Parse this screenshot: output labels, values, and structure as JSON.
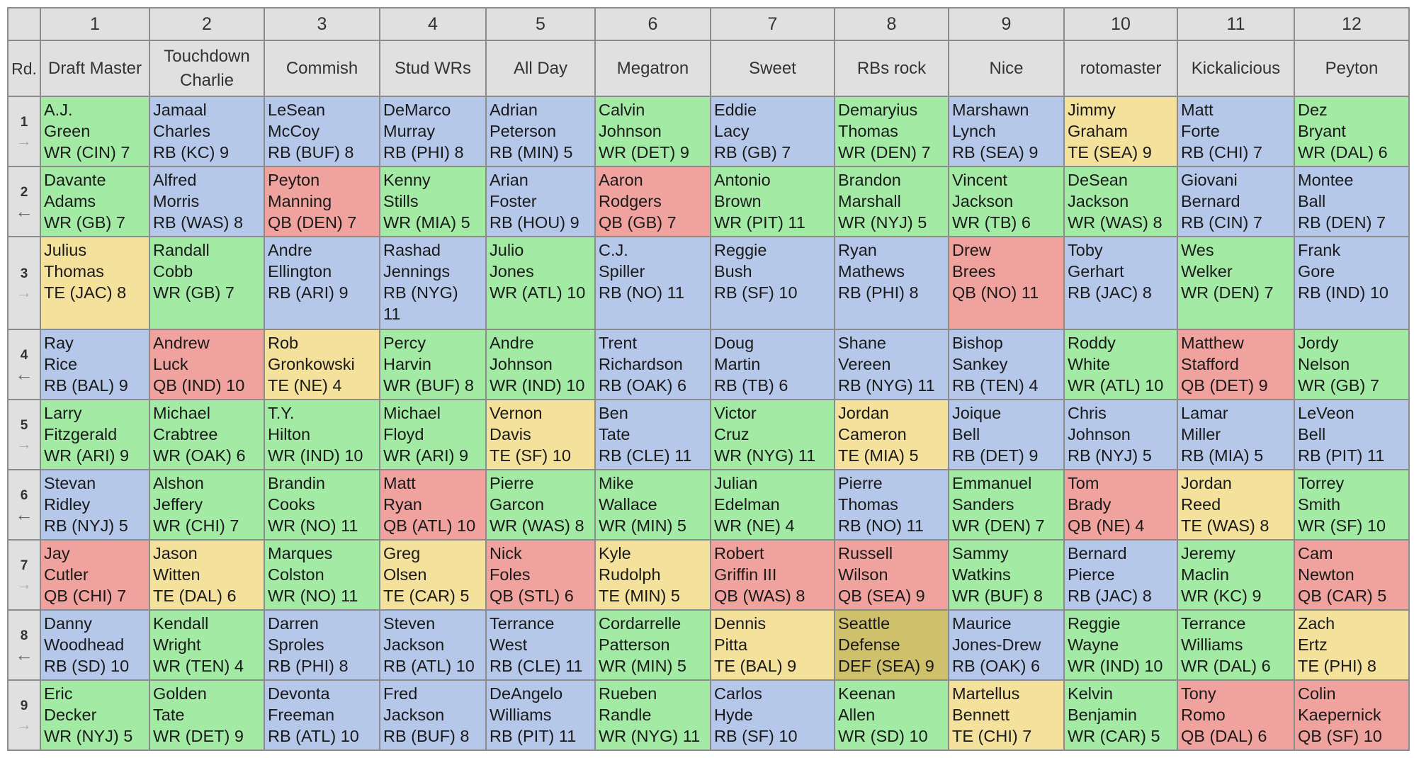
{
  "colors": {
    "WR": "#a3eba5",
    "RB": "#b6c8ea",
    "QB": "#f0a39e",
    "TE": "#f3e19c",
    "DEF": "#cfc06c",
    "header": "#e0e0e0"
  },
  "header": {
    "rd_label": "Rd.",
    "team_numbers": [
      "1",
      "2",
      "3",
      "4",
      "5",
      "6",
      "7",
      "8",
      "9",
      "10",
      "11",
      "12"
    ],
    "team_names": [
      "Draft Master",
      "Touchdown Charlie",
      "Commish",
      "Stud WRs",
      "All Day",
      "Megatron",
      "Sweet",
      "RBs rock",
      "Nice",
      "rotomaster",
      "Kickalicious",
      "Peyton"
    ]
  },
  "rounds": [
    {
      "num": "1",
      "direction": "right",
      "picks": [
        {
          "first": "A.J.",
          "last": "Green",
          "pos": "WR",
          "info": "WR (CIN) 7"
        },
        {
          "first": "Jamaal",
          "last": "Charles",
          "pos": "RB",
          "info": "RB (KC) 9"
        },
        {
          "first": "LeSean",
          "last": "McCoy",
          "pos": "RB",
          "info": "RB (BUF) 8"
        },
        {
          "first": "DeMarco",
          "last": "Murray",
          "pos": "RB",
          "info": "RB (PHI) 8"
        },
        {
          "first": "Adrian",
          "last": "Peterson",
          "pos": "RB",
          "info": "RB (MIN) 5"
        },
        {
          "first": "Calvin",
          "last": "Johnson",
          "pos": "WR",
          "info": "WR (DET) 9"
        },
        {
          "first": "Eddie",
          "last": "Lacy",
          "pos": "RB",
          "info": "RB (GB) 7"
        },
        {
          "first": "Demaryius",
          "last": "Thomas",
          "pos": "WR",
          "info": "WR (DEN) 7"
        },
        {
          "first": "Marshawn",
          "last": "Lynch",
          "pos": "RB",
          "info": "RB (SEA) 9"
        },
        {
          "first": "Jimmy",
          "last": "Graham",
          "pos": "TE",
          "info": "TE (SEA) 9"
        },
        {
          "first": "Matt",
          "last": "Forte",
          "pos": "RB",
          "info": "RB (CHI) 7"
        },
        {
          "first": "Dez",
          "last": "Bryant",
          "pos": "WR",
          "info": "WR (DAL) 6"
        }
      ]
    },
    {
      "num": "2",
      "direction": "left",
      "picks": [
        {
          "first": "Davante",
          "last": "Adams",
          "pos": "WR",
          "info": "WR (GB) 7"
        },
        {
          "first": "Alfred",
          "last": "Morris",
          "pos": "RB",
          "info": "RB (WAS) 8"
        },
        {
          "first": "Peyton",
          "last": "Manning",
          "pos": "QB",
          "info": "QB (DEN) 7"
        },
        {
          "first": "Kenny",
          "last": "Stills",
          "pos": "WR",
          "info": "WR (MIA) 5"
        },
        {
          "first": "Arian",
          "last": "Foster",
          "pos": "RB",
          "info": "RB (HOU) 9"
        },
        {
          "first": "Aaron",
          "last": "Rodgers",
          "pos": "QB",
          "info": "QB (GB) 7"
        },
        {
          "first": "Antonio",
          "last": "Brown",
          "pos": "WR",
          "info": "WR (PIT) 11"
        },
        {
          "first": "Brandon",
          "last": "Marshall",
          "pos": "WR",
          "info": "WR (NYJ) 5"
        },
        {
          "first": "Vincent",
          "last": "Jackson",
          "pos": "WR",
          "info": "WR (TB) 6"
        },
        {
          "first": "DeSean",
          "last": "Jackson",
          "pos": "WR",
          "info": "WR (WAS) 8"
        },
        {
          "first": "Giovani",
          "last": "Bernard",
          "pos": "RB",
          "info": "RB (CIN) 7"
        },
        {
          "first": "Montee",
          "last": "Ball",
          "pos": "RB",
          "info": "RB (DEN) 7"
        }
      ]
    },
    {
      "num": "3",
      "direction": "right",
      "picks": [
        {
          "first": "Julius",
          "last": "Thomas",
          "pos": "TE",
          "info": "TE (JAC) 8"
        },
        {
          "first": "Randall",
          "last": "Cobb",
          "pos": "WR",
          "info": "WR (GB) 7"
        },
        {
          "first": "Andre",
          "last": "Ellington",
          "pos": "RB",
          "info": "RB (ARI) 9"
        },
        {
          "first": "Rashad",
          "last": "Jennings",
          "pos": "RB",
          "info": "RB (NYG)",
          "extra": "11"
        },
        {
          "first": "Julio",
          "last": "Jones",
          "pos": "WR",
          "info": "WR (ATL) 10"
        },
        {
          "first": "C.J.",
          "last": "Spiller",
          "pos": "RB",
          "info": "RB (NO) 11"
        },
        {
          "first": "Reggie",
          "last": "Bush",
          "pos": "RB",
          "info": "RB (SF) 10"
        },
        {
          "first": "Ryan",
          "last": "Mathews",
          "pos": "RB",
          "info": "RB (PHI) 8"
        },
        {
          "first": "Drew",
          "last": "Brees",
          "pos": "QB",
          "info": "QB (NO) 11"
        },
        {
          "first": "Toby",
          "last": "Gerhart",
          "pos": "RB",
          "info": "RB (JAC) 8"
        },
        {
          "first": "Wes",
          "last": "Welker",
          "pos": "WR",
          "info": "WR (DEN) 7"
        },
        {
          "first": "Frank",
          "last": "Gore",
          "pos": "RB",
          "info": "RB (IND) 10"
        }
      ]
    },
    {
      "num": "4",
      "direction": "left",
      "picks": [
        {
          "first": "Ray",
          "last": "Rice",
          "pos": "RB",
          "info": "RB (BAL) 9"
        },
        {
          "first": "Andrew",
          "last": "Luck",
          "pos": "QB",
          "info": "QB (IND) 10"
        },
        {
          "first": "Rob",
          "last": "Gronkowski",
          "pos": "TE",
          "info": "TE (NE) 4"
        },
        {
          "first": "Percy",
          "last": "Harvin",
          "pos": "WR",
          "info": "WR (BUF) 8"
        },
        {
          "first": "Andre",
          "last": "Johnson",
          "pos": "WR",
          "info": "WR (IND) 10"
        },
        {
          "first": "Trent",
          "last": "Richardson",
          "pos": "RB",
          "info": "RB (OAK) 6"
        },
        {
          "first": "Doug",
          "last": "Martin",
          "pos": "RB",
          "info": "RB (TB) 6"
        },
        {
          "first": "Shane",
          "last": "Vereen",
          "pos": "RB",
          "info": "RB (NYG) 11"
        },
        {
          "first": "Bishop",
          "last": "Sankey",
          "pos": "RB",
          "info": "RB (TEN) 4"
        },
        {
          "first": "Roddy",
          "last": "White",
          "pos": "WR",
          "info": "WR (ATL) 10"
        },
        {
          "first": "Matthew",
          "last": "Stafford",
          "pos": "QB",
          "info": "QB (DET) 9"
        },
        {
          "first": "Jordy",
          "last": "Nelson",
          "pos": "WR",
          "info": "WR (GB) 7"
        }
      ]
    },
    {
      "num": "5",
      "direction": "right",
      "picks": [
        {
          "first": "Larry",
          "last": "Fitzgerald",
          "pos": "WR",
          "info": "WR (ARI) 9"
        },
        {
          "first": "Michael",
          "last": "Crabtree",
          "pos": "WR",
          "info": "WR (OAK) 6"
        },
        {
          "first": "T.Y.",
          "last": "Hilton",
          "pos": "WR",
          "info": "WR (IND) 10"
        },
        {
          "first": "Michael",
          "last": "Floyd",
          "pos": "WR",
          "info": "WR (ARI) 9"
        },
        {
          "first": "Vernon",
          "last": "Davis",
          "pos": "TE",
          "info": "TE (SF) 10"
        },
        {
          "first": "Ben",
          "last": "Tate",
          "pos": "RB",
          "info": "RB (CLE) 11"
        },
        {
          "first": "Victor",
          "last": "Cruz",
          "pos": "WR",
          "info": "WR (NYG) 11"
        },
        {
          "first": "Jordan",
          "last": "Cameron",
          "pos": "TE",
          "info": "TE (MIA) 5"
        },
        {
          "first": "Joique",
          "last": "Bell",
          "pos": "RB",
          "info": "RB (DET) 9"
        },
        {
          "first": "Chris",
          "last": "Johnson",
          "pos": "RB",
          "info": "RB (NYJ) 5"
        },
        {
          "first": "Lamar",
          "last": "Miller",
          "pos": "RB",
          "info": "RB (MIA) 5"
        },
        {
          "first": "LeVeon",
          "last": "Bell",
          "pos": "RB",
          "info": "RB (PIT) 11"
        }
      ]
    },
    {
      "num": "6",
      "direction": "left",
      "picks": [
        {
          "first": "Stevan",
          "last": "Ridley",
          "pos": "RB",
          "info": "RB (NYJ) 5"
        },
        {
          "first": "Alshon",
          "last": "Jeffery",
          "pos": "WR",
          "info": "WR (CHI) 7"
        },
        {
          "first": "Brandin",
          "last": "Cooks",
          "pos": "WR",
          "info": "WR (NO) 11"
        },
        {
          "first": "Matt",
          "last": "Ryan",
          "pos": "QB",
          "info": "QB (ATL) 10"
        },
        {
          "first": "Pierre",
          "last": "Garcon",
          "pos": "WR",
          "info": "WR (WAS) 8"
        },
        {
          "first": "Mike",
          "last": "Wallace",
          "pos": "WR",
          "info": "WR (MIN) 5"
        },
        {
          "first": "Julian",
          "last": "Edelman",
          "pos": "WR",
          "info": "WR (NE) 4"
        },
        {
          "first": "Pierre",
          "last": "Thomas",
          "pos": "RB",
          "info": "RB (NO) 11"
        },
        {
          "first": "Emmanuel",
          "last": "Sanders",
          "pos": "WR",
          "info": "WR (DEN) 7"
        },
        {
          "first": "Tom",
          "last": "Brady",
          "pos": "QB",
          "info": "QB (NE) 4"
        },
        {
          "first": "Jordan",
          "last": "Reed",
          "pos": "TE",
          "info": "TE (WAS) 8"
        },
        {
          "first": "Torrey",
          "last": "Smith",
          "pos": "WR",
          "info": "WR (SF) 10"
        }
      ]
    },
    {
      "num": "7",
      "direction": "right",
      "picks": [
        {
          "first": "Jay",
          "last": "Cutler",
          "pos": "QB",
          "info": "QB (CHI) 7"
        },
        {
          "first": "Jason",
          "last": "Witten",
          "pos": "TE",
          "info": "TE (DAL) 6"
        },
        {
          "first": "Marques",
          "last": "Colston",
          "pos": "WR",
          "info": "WR (NO) 11"
        },
        {
          "first": "Greg",
          "last": "Olsen",
          "pos": "TE",
          "info": "TE (CAR) 5"
        },
        {
          "first": "Nick",
          "last": "Foles",
          "pos": "QB",
          "info": "QB (STL) 6"
        },
        {
          "first": "Kyle",
          "last": "Rudolph",
          "pos": "TE",
          "info": "TE (MIN) 5"
        },
        {
          "first": "Robert",
          "last": "Griffin III",
          "pos": "QB",
          "info": "QB (WAS) 8"
        },
        {
          "first": "Russell",
          "last": "Wilson",
          "pos": "QB",
          "info": "QB (SEA) 9"
        },
        {
          "first": "Sammy",
          "last": "Watkins",
          "pos": "WR",
          "info": "WR (BUF) 8"
        },
        {
          "first": "Bernard",
          "last": "Pierce",
          "pos": "RB",
          "info": "RB (JAC) 8"
        },
        {
          "first": "Jeremy",
          "last": "Maclin",
          "pos": "WR",
          "info": "WR (KC) 9"
        },
        {
          "first": "Cam",
          "last": "Newton",
          "pos": "QB",
          "info": "QB (CAR) 5"
        }
      ]
    },
    {
      "num": "8",
      "direction": "left",
      "picks": [
        {
          "first": "Danny",
          "last": "Woodhead",
          "pos": "RB",
          "info": "RB (SD) 10"
        },
        {
          "first": "Kendall",
          "last": "Wright",
          "pos": "WR",
          "info": "WR (TEN) 4"
        },
        {
          "first": "Darren",
          "last": "Sproles",
          "pos": "RB",
          "info": "RB (PHI) 8"
        },
        {
          "first": "Steven",
          "last": "Jackson",
          "pos": "RB",
          "info": "RB (ATL) 10"
        },
        {
          "first": "Terrance",
          "last": "West",
          "pos": "RB",
          "info": "RB (CLE) 11"
        },
        {
          "first": "Cordarrelle",
          "last": "Patterson",
          "pos": "WR",
          "info": "WR (MIN) 5"
        },
        {
          "first": "Dennis",
          "last": "Pitta",
          "pos": "TE",
          "info": "TE (BAL) 9"
        },
        {
          "first": "Seattle",
          "last": "Defense",
          "pos": "DEF",
          "info": "DEF (SEA) 9"
        },
        {
          "first": "Maurice",
          "last": "Jones-Drew",
          "pos": "RB",
          "info": "RB (OAK) 6"
        },
        {
          "first": "Reggie",
          "last": "Wayne",
          "pos": "WR",
          "info": "WR (IND) 10"
        },
        {
          "first": "Terrance",
          "last": "Williams",
          "pos": "WR",
          "info": "WR (DAL) 6"
        },
        {
          "first": "Zach",
          "last": "Ertz",
          "pos": "TE",
          "info": "TE (PHI) 8"
        }
      ]
    },
    {
      "num": "9",
      "direction": "right",
      "picks": [
        {
          "first": "Eric",
          "last": "Decker",
          "pos": "WR",
          "info": "WR (NYJ) 5"
        },
        {
          "first": "Golden",
          "last": "Tate",
          "pos": "WR",
          "info": "WR (DET) 9"
        },
        {
          "first": "Devonta",
          "last": "Freeman",
          "pos": "RB",
          "info": "RB (ATL) 10"
        },
        {
          "first": "Fred",
          "last": "Jackson",
          "pos": "RB",
          "info": "RB (BUF) 8"
        },
        {
          "first": "DeAngelo",
          "last": "Williams",
          "pos": "RB",
          "info": "RB (PIT) 11"
        },
        {
          "first": "Rueben",
          "last": "Randle",
          "pos": "WR",
          "info": "WR (NYG) 11"
        },
        {
          "first": "Carlos",
          "last": "Hyde",
          "pos": "RB",
          "info": "RB (SF) 10"
        },
        {
          "first": "Keenan",
          "last": "Allen",
          "pos": "WR",
          "info": "WR (SD) 10"
        },
        {
          "first": "Martellus",
          "last": "Bennett",
          "pos": "TE",
          "info": "TE (CHI) 7"
        },
        {
          "first": "Kelvin",
          "last": "Benjamin",
          "pos": "WR",
          "info": "WR (CAR) 5"
        },
        {
          "first": "Tony",
          "last": "Romo",
          "pos": "QB",
          "info": "QB (DAL) 6"
        },
        {
          "first": "Colin",
          "last": "Kaepernick",
          "pos": "QB",
          "info": "QB (SF) 10"
        }
      ]
    }
  ]
}
